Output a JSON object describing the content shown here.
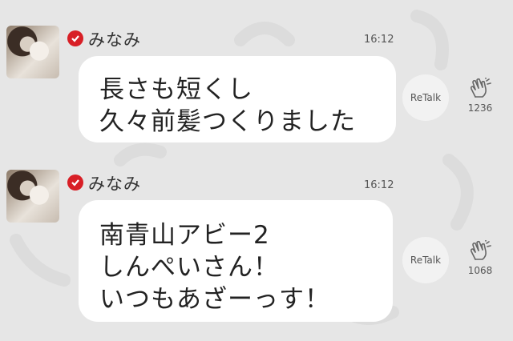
{
  "messages": [
    {
      "username": "みなみ",
      "time": "16:12",
      "lines": [
        "長さも短くし",
        "久々前髪つくりました"
      ],
      "retalk_label": "ReTalk",
      "clap_count": "1236"
    },
    {
      "username": "みなみ",
      "time": "16:12",
      "lines": [
        "南青山アビー2",
        "しんぺいさん！",
        "いつもあざーっす！"
      ],
      "retalk_label": "ReTalk",
      "clap_count": "1068"
    }
  ],
  "icons": {
    "verified": "verified-check-icon",
    "clap": "clap-hands-icon"
  },
  "colors": {
    "background": "#e6e6e6",
    "bubble": "#ffffff",
    "verified": "#d81f26"
  }
}
